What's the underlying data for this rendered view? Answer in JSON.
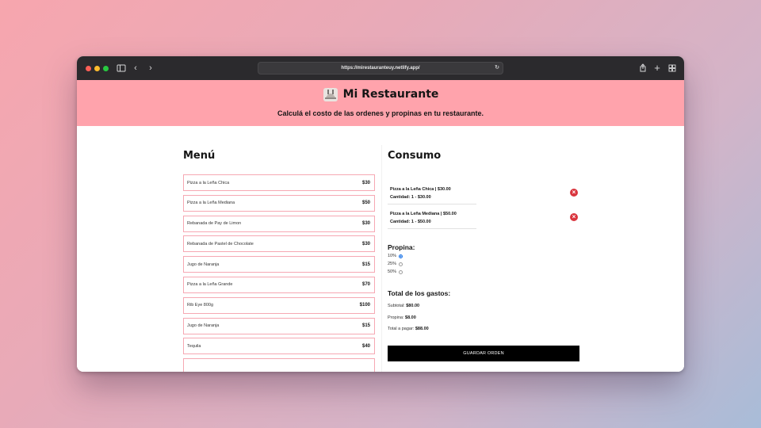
{
  "browser": {
    "url": "https://mirestauranteuy.netlify.app/",
    "icons": [
      "sidebar-icon",
      "back-icon",
      "forward-icon",
      "reload-icon",
      "share-icon",
      "new-tab-icon",
      "tab-overview-icon"
    ]
  },
  "header": {
    "title": "Mi Restaurante",
    "subtitle": "Calculá el costo de las ordenes y propinas en tu restaurante.",
    "logo_icon": "cloche-serving-icon"
  },
  "menu": {
    "title": "Menú",
    "items": [
      {
        "name": "Pizza a la Leña Chica",
        "price": "$30"
      },
      {
        "name": "Pizza a la Leña Mediana",
        "price": "$50"
      },
      {
        "name": "Rebanada de Pay de Limon",
        "price": "$30"
      },
      {
        "name": "Rebanada de Pastel de Chocolate",
        "price": "$30"
      },
      {
        "name": "Jugo de Naranja",
        "price": "$15"
      },
      {
        "name": "Pizza a la Leña Grande",
        "price": "$70"
      },
      {
        "name": "Rib Eye 800g",
        "price": "$100"
      },
      {
        "name": "Jugo de Naranja",
        "price": "$15"
      },
      {
        "name": "Tequila",
        "price": "$40"
      },
      {
        "name": "",
        "price": ""
      }
    ]
  },
  "consumo": {
    "title": "Consumo",
    "orders": [
      {
        "line1": "Pizza a la Leña Chica | $30.00",
        "line2": "Cantidad: 1 - $30.00"
      },
      {
        "line1": "Pizza a la Leña Mediana | $50.00",
        "line2": "Cantidad: 1 - $50.00"
      }
    ],
    "remove_icon": "×"
  },
  "propina": {
    "title": "Propina:",
    "options": [
      {
        "label": "10%",
        "selected": true
      },
      {
        "label": "25%",
        "selected": false
      },
      {
        "label": "50%",
        "selected": false
      }
    ]
  },
  "totales": {
    "title": "Total de los gastos:",
    "subtotal_label": "Subtotal:",
    "subtotal_value": "$80.00",
    "propina_label": "Propina:",
    "propina_value": "$8.00",
    "total_label": "Total a pagar:",
    "total_value": "$88.00"
  },
  "save_button": "GUARDAR ORDEN",
  "colors": {
    "header_bg": "#ffa3ac",
    "item_border": "#f6a8b3",
    "remove": "#d9353e",
    "button": "#000000"
  }
}
